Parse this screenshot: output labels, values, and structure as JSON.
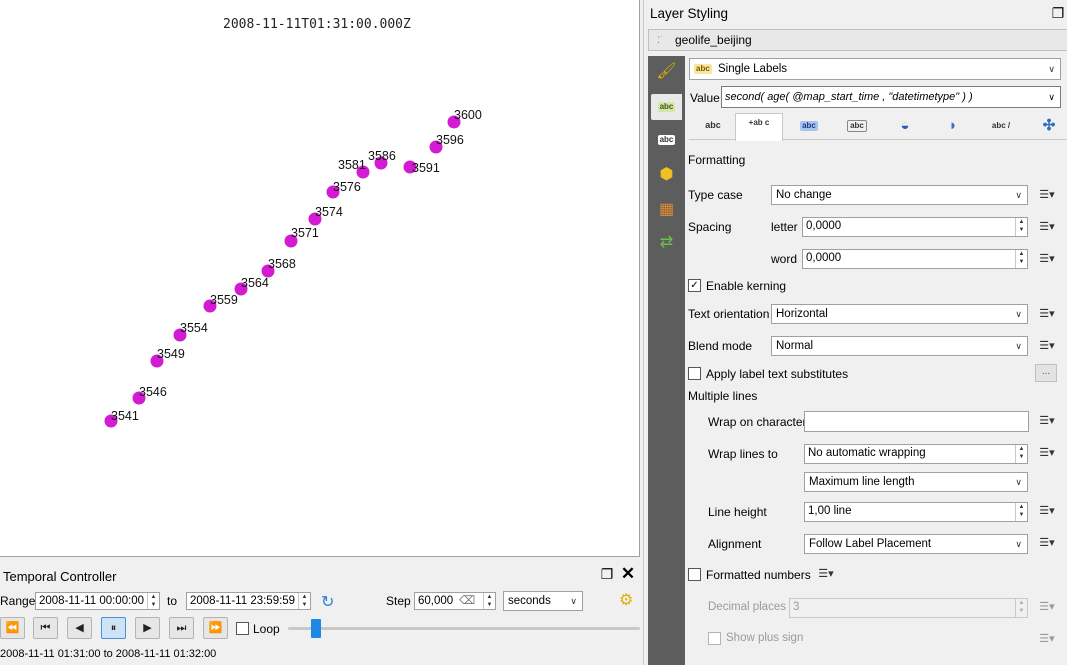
{
  "map": {
    "timestamp": "2008-11-11T01:31:00.000Z",
    "point_color": "#d21bd2",
    "points": [
      {
        "label": "3541"
      },
      {
        "label": "3546"
      },
      {
        "label": "3549"
      },
      {
        "label": "3554"
      },
      {
        "label": "3559"
      },
      {
        "label": "3564"
      },
      {
        "label": "3568"
      },
      {
        "label": "3571"
      },
      {
        "label": "3574"
      },
      {
        "label": "3576"
      },
      {
        "label": "3581"
      },
      {
        "label": "3586"
      },
      {
        "label": "3591"
      },
      {
        "label": "3596"
      },
      {
        "label": "3600"
      }
    ]
  },
  "temporal": {
    "title": "Temporal Controller",
    "range_label": "Range",
    "range_start": "2008-11-11 00:00:00",
    "to_label": "to",
    "range_end": "2008-11-11 23:59:59",
    "step_label": "Step",
    "step_value": "60,000",
    "step_unit": "seconds",
    "loop_label": "Loop",
    "playback_progress": 0.08,
    "status": "2008-11-11 01:31:00 to 2008-11-11 01:32:00",
    "accent_color": "#1e88e5"
  },
  "styling": {
    "title": "Layer Styling",
    "layer_name": "geolife_beijing",
    "renderer": "Single Labels",
    "value_label": "Value",
    "value_expression": "second( age( @map_start_time , \"datetimetype\" ) )",
    "tabs": [
      "abc",
      "+ab c",
      "abc",
      "abc",
      "shield",
      "shadow",
      "abc /",
      "move"
    ],
    "section_title": "Formatting",
    "type_case_label": "Type case",
    "type_case_value": "No change",
    "spacing_label": "Spacing",
    "letter_label": "letter",
    "letter_value": "0,0000",
    "word_label": "word",
    "word_value": "0,0000",
    "kerning_label": "Enable kerning",
    "kerning_checked": true,
    "orientation_label": "Text orientation",
    "orientation_value": "Horizontal",
    "blend_label": "Blend mode",
    "blend_value": "Normal",
    "substitutes_label": "Apply label text substitutes",
    "substitutes_button": "...",
    "multiline_label": "Multiple lines",
    "wrap_char_label": "Wrap on character",
    "wrap_char_value": "",
    "wrap_lines_label": "Wrap lines to",
    "wrap_lines_value": "No automatic wrapping",
    "wrap_mode_value": "Maximum line length",
    "line_height_label": "Line height",
    "line_height_value": "1,00 line",
    "alignment_label": "Alignment",
    "alignment_value": "Follow Label Placement",
    "formatted_numbers_label": "Formatted numbers",
    "decimal_places_label": "Decimal places",
    "decimal_places_value": "3",
    "plus_sign_label": "Show plus sign"
  }
}
